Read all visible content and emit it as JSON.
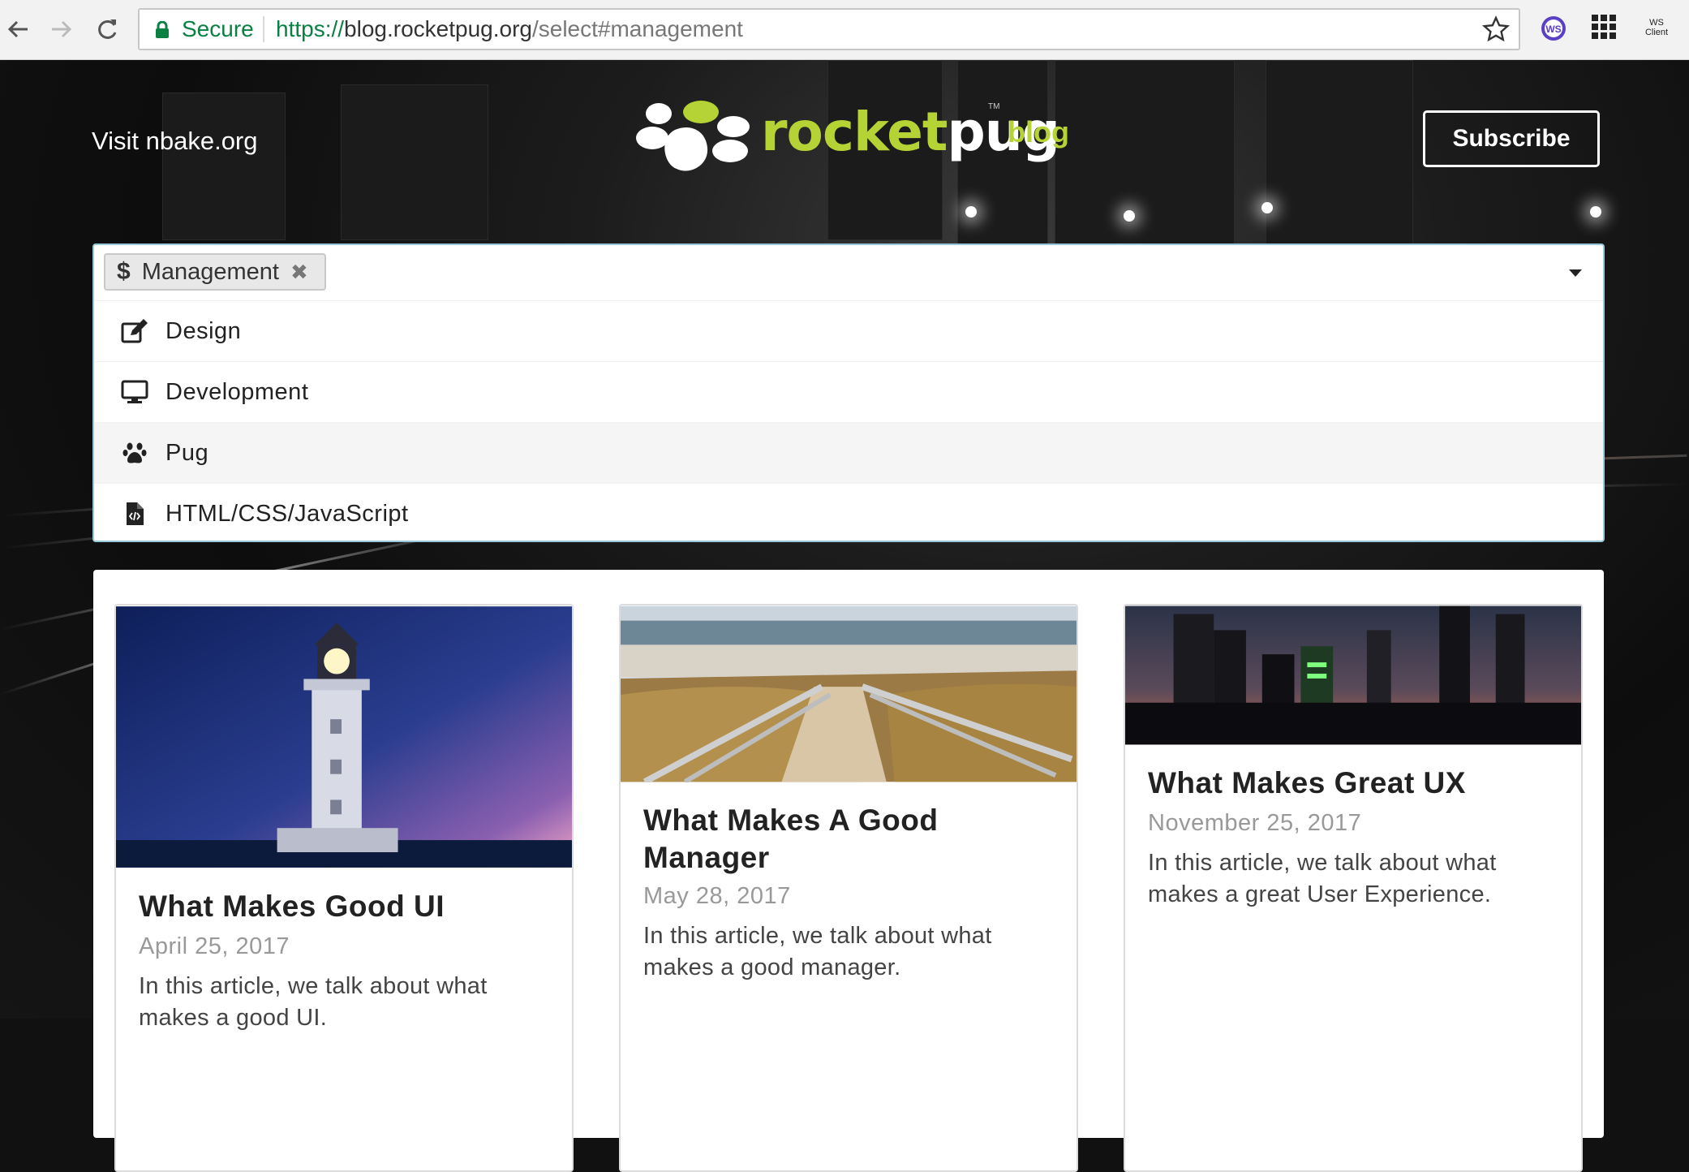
{
  "browser": {
    "secure_label": "Secure",
    "url_scheme": "https://",
    "url_host": "blog.rocketpug.org",
    "url_path": "/select#management",
    "ext_label_line1": "WS",
    "ext_label_line2": "Client"
  },
  "header": {
    "visit_link": "Visit nbake.org",
    "logo_rocket": "rocket",
    "logo_pug": "pug",
    "logo_tm": "TM",
    "logo_blog": "blog",
    "subscribe_label": "Subscribe"
  },
  "select": {
    "selected_label": "Management",
    "selected_icon": "dollar-icon",
    "options": [
      {
        "label": "Design",
        "icon": "edit-icon"
      },
      {
        "label": "Development",
        "icon": "desktop-icon"
      },
      {
        "label": "Pug",
        "icon": "paw-icon"
      },
      {
        "label": "HTML/CSS/JavaScript",
        "icon": "file-code-icon"
      }
    ]
  },
  "cards": [
    {
      "title": "What Makes Good UI",
      "date": "April 25, 2017",
      "desc": "In this article, we talk about what makes a good UI."
    },
    {
      "title": "What Makes A Good Manager",
      "date": "May 28, 2017",
      "desc": "In this article, we talk about what makes a good manager."
    },
    {
      "title": "What Makes Great UX",
      "date": "November 25, 2017",
      "desc": "In this article, we talk about what makes a great User Experience."
    }
  ],
  "colors": {
    "brand_green": "#b5d334",
    "secure_green": "#0b8043",
    "focus_border": "#96c8da"
  }
}
